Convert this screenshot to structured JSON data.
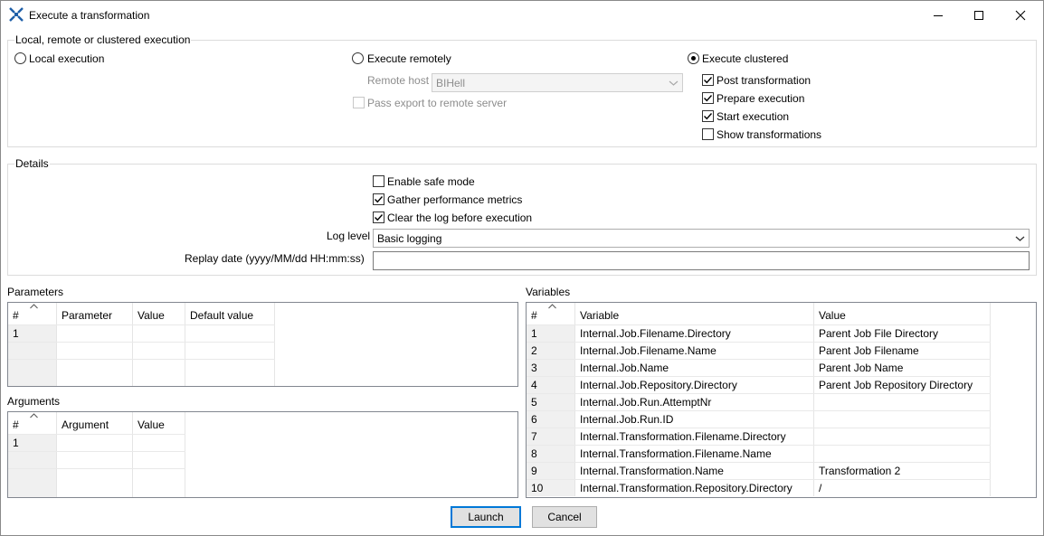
{
  "window": {
    "title": "Execute a transformation"
  },
  "execution": {
    "group_title": "Local, remote or clustered execution",
    "local": {
      "label": "Local execution",
      "checked": false
    },
    "remote": {
      "label": "Execute remotely",
      "checked": false,
      "host_label": "Remote host",
      "host_value": "BIHell",
      "pass_export_label": "Pass export to remote server"
    },
    "clustered": {
      "label": "Execute clustered",
      "checked": true,
      "options": [
        {
          "label": "Post transformation",
          "checked": true
        },
        {
          "label": "Prepare execution",
          "checked": true
        },
        {
          "label": "Start execution",
          "checked": true
        },
        {
          "label": "Show transformations",
          "checked": false
        }
      ]
    }
  },
  "details": {
    "group_title": "Details",
    "safe_mode": {
      "label": "Enable safe mode",
      "checked": false
    },
    "perf_metrics": {
      "label": "Gather performance metrics",
      "checked": true
    },
    "clear_log": {
      "label": "Clear the log before execution",
      "checked": true
    },
    "log_level_label": "Log level",
    "log_level_value": "Basic logging",
    "replay_date_label": "Replay date (yyyy/MM/dd HH:mm:ss)",
    "replay_date_value": ""
  },
  "parameters": {
    "title": "Parameters",
    "columns": [
      "#",
      "Parameter",
      "Value",
      "Default value"
    ],
    "rows": [
      [
        "1",
        "",
        "",
        ""
      ]
    ]
  },
  "arguments": {
    "title": "Arguments",
    "columns": [
      "#",
      "Argument",
      "Value"
    ],
    "rows": [
      [
        "1",
        "",
        ""
      ]
    ]
  },
  "variables": {
    "title": "Variables",
    "columns": [
      "#",
      "Variable",
      "Value"
    ],
    "rows": [
      [
        "1",
        "Internal.Job.Filename.Directory",
        "Parent Job File Directory"
      ],
      [
        "2",
        "Internal.Job.Filename.Name",
        "Parent Job Filename"
      ],
      [
        "3",
        "Internal.Job.Name",
        "Parent Job Name"
      ],
      [
        "4",
        "Internal.Job.Repository.Directory",
        "Parent Job Repository Directory"
      ],
      [
        "5",
        "Internal.Job.Run.AttemptNr",
        ""
      ],
      [
        "6",
        "Internal.Job.Run.ID",
        ""
      ],
      [
        "7",
        "Internal.Transformation.Filename.Directory",
        ""
      ],
      [
        "8",
        "Internal.Transformation.Filename.Name",
        ""
      ],
      [
        "9",
        "Internal.Transformation.Name",
        "Transformation 2"
      ],
      [
        "10",
        "Internal.Transformation.Repository.Directory",
        "/"
      ]
    ]
  },
  "buttons": {
    "launch": "Launch",
    "cancel": "Cancel"
  },
  "colors": {
    "accent": "#0078d7",
    "icon_blue": "#1e5fa8"
  }
}
